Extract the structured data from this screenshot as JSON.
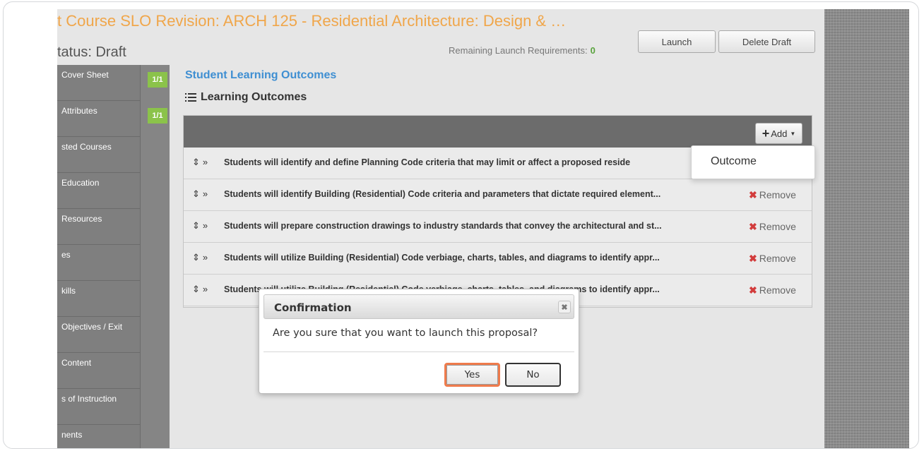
{
  "header": {
    "title": "t Course SLO Revision: ARCH 125 - Residential Architecture: Design & …",
    "status": "tatus: Draft",
    "remaining_label": "Remaining Launch Requirements:",
    "remaining_count": "0",
    "launch_label": "Launch",
    "delete_label": "Delete Draft"
  },
  "sidebar": {
    "items": [
      {
        "label": "Cover Sheet",
        "badge": "1/1"
      },
      {
        "label": "Attributes",
        "badge": "1/1"
      },
      {
        "label": "sted Courses",
        "badge": ""
      },
      {
        "label": "Education",
        "badge": ""
      },
      {
        "label": "Resources",
        "badge": ""
      },
      {
        "label": "es",
        "badge": ""
      },
      {
        "label": "kills",
        "badge": ""
      },
      {
        "label": "Objectives / Exit",
        "badge": ""
      },
      {
        "label": "Content",
        "badge": ""
      },
      {
        "label": "s of Instruction",
        "badge": ""
      },
      {
        "label": "nents",
        "badge": ""
      }
    ]
  },
  "main": {
    "section_title": "Student Learning Outcomes",
    "list_title": "Learning Outcomes",
    "add_label": "Add",
    "remove_label": "Remove",
    "outcomes": [
      "Students will identify and define Planning Code criteria that may limit or affect a proposed reside",
      "Students will identify Building (Residential) Code criteria and parameters that dictate required element...",
      "Students will prepare construction drawings to industry standards that convey the architectural and st...",
      "Students will utilize Building (Residential) Code verbiage, charts, tables, and diagrams to identify appr...",
      "Students will utilize Building (Residential) Code verbiage, charts, tables, and diagrams to identify appr..."
    ]
  },
  "dropdown": {
    "option": "Outcome"
  },
  "dialog": {
    "title": "Confirmation",
    "message": "Are you sure that you want to launch this proposal?",
    "yes_label": "Yes",
    "no_label": "No"
  },
  "colors": {
    "title": "#f0a64a",
    "link": "#3f8fd2",
    "badge": "#8bc34a",
    "highlight": "#ef7b4c",
    "remove_x": "#d23c3c"
  }
}
